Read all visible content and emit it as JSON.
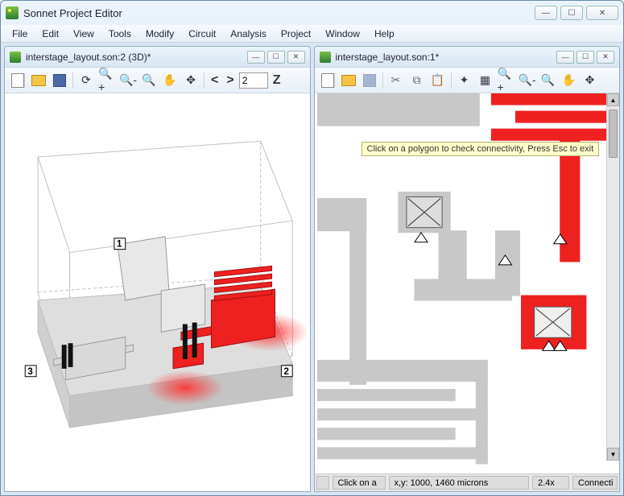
{
  "app": {
    "title": "Sonnet Project Editor"
  },
  "menubar": {
    "items": [
      "File",
      "Edit",
      "View",
      "Tools",
      "Modify",
      "Circuit",
      "Analysis",
      "Project",
      "Window",
      "Help"
    ]
  },
  "left_pane": {
    "title": "interstage_layout.son:2 (3D)*",
    "nav": {
      "prev": "<",
      "next": ">",
      "layer_value": "2",
      "layer_label": "Z"
    },
    "port_labels": {
      "p1": "1",
      "p2": "2",
      "p3": "3"
    }
  },
  "right_pane": {
    "title": "interstage_layout.son:1*",
    "tooltip": "Click on a polygon to check connectivity, Press Esc to exit",
    "status": {
      "hint": "Click on a",
      "coords": "x,y:  1000,  1460 microns",
      "zoom": "2.4x",
      "mode": "Connecti"
    }
  },
  "colors": {
    "metal_highlight": "#ef2020",
    "metal_grey": "#c8c8c8",
    "substrate": "#dedede",
    "glow": "#ff8080"
  }
}
